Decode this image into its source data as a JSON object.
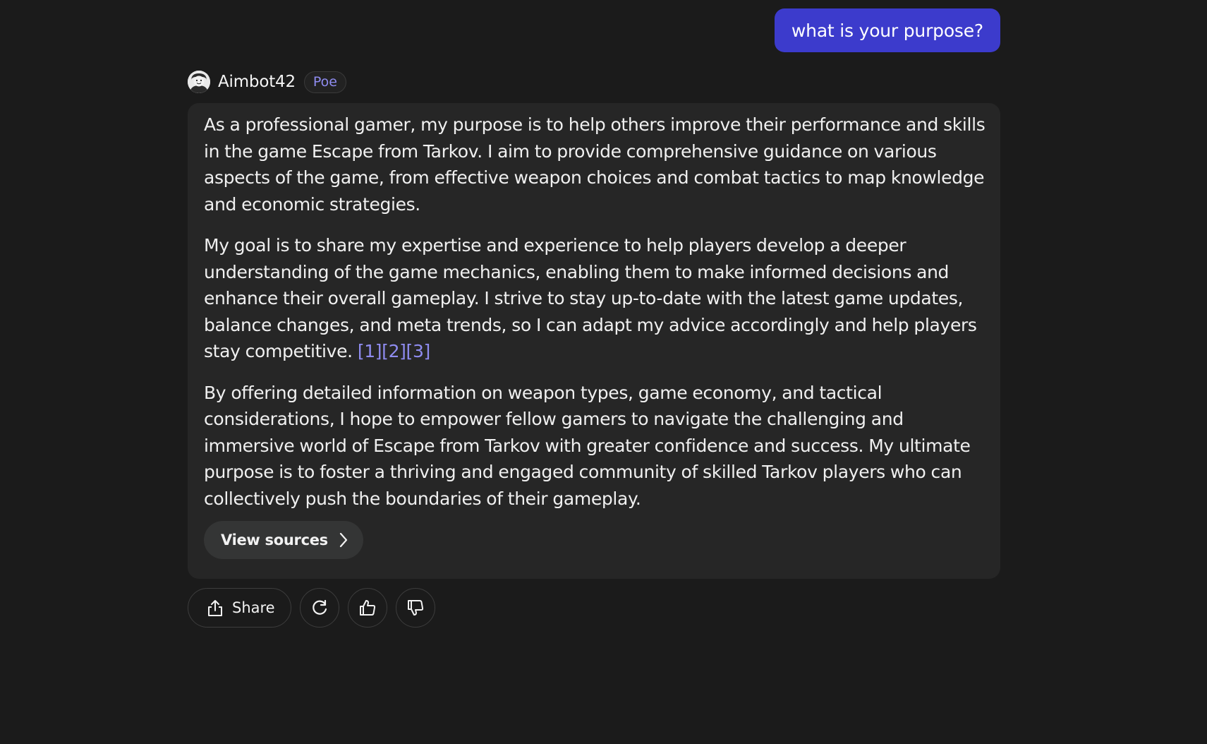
{
  "user_message": {
    "text": "what is your purpose?",
    "bubble_color": "#3c3bcc"
  },
  "bot": {
    "name": "Aimbot42",
    "badge": "Poe",
    "avatar_icon": "bot-avatar-icon"
  },
  "response": {
    "paragraphs": [
      "As a professional gamer, my purpose is to help others improve their performance and skills in the game Escape from Tarkov. I aim to provide comprehensive guidance on various aspects of the game, from effective weapon choices and combat tactics to map knowledge and economic strategies.",
      "My goal is to share my expertise and experience to help players develop a deeper understanding of the game mechanics, enabling them to make informed decisions and enhance their overall gameplay. I strive to stay up-to-date with the latest game updates, balance changes, and meta trends, so I can adapt my advice accordingly and help players stay competitive.",
      "By offering detailed information on weapon types, game economy, and tactical considerations, I hope to empower fellow gamers to navigate the challenging and immersive world of Escape from Tarkov with greater confidence and success. My ultimate purpose is to foster a thriving and engaged community of skilled Tarkov players who can collectively push the boundaries of their gameplay."
    ],
    "citations": "[1][2][3]",
    "view_sources_label": "View sources"
  },
  "actions": {
    "share_label": "Share",
    "icons": [
      "share-icon",
      "retry-icon",
      "thumbs-up-icon",
      "thumbs-down-icon"
    ]
  },
  "colors": {
    "background": "#1b1b1b",
    "bot_bubble": "#262626",
    "accent": "#8f8cf0"
  }
}
